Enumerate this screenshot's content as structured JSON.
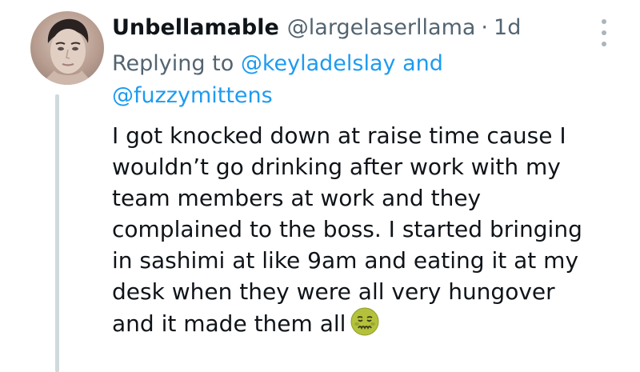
{
  "tweet": {
    "display_name": "Unbellamable",
    "handle": "@largelaserllama",
    "separator": "·",
    "time": "1d",
    "reply": {
      "prefix": "Replying to",
      "mention_1": "@keyladelslay",
      "conjunction": "and",
      "mention_2": "@fuzzymittens"
    },
    "text_lines": [
      "I got knocked down at raise time cause I",
      "wouldn’t go drinking after work with my",
      "team members at work and they",
      "complained to the boss. I started bringing",
      "in sashimi at like 9am and eating it at my",
      "desk when they were all very hungover",
      "and it made them all"
    ],
    "emoji_icon": "nauseated-face-icon"
  },
  "colors": {
    "text": "#0f1419",
    "secondary": "#536471",
    "link": "#1d9bf0",
    "thread_line": "#cfd9de"
  }
}
